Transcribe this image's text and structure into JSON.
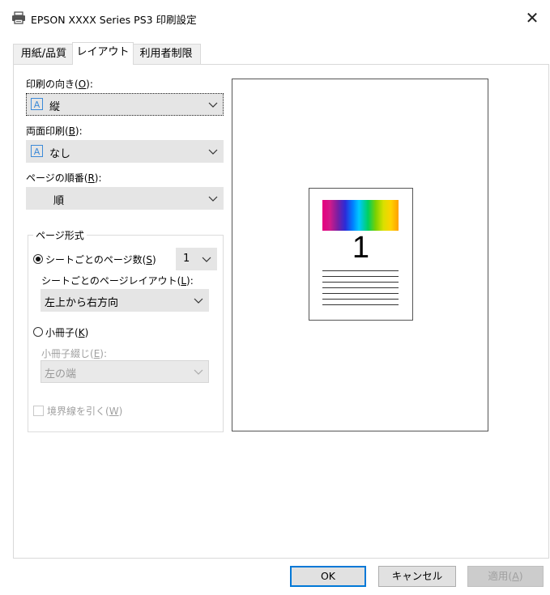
{
  "window": {
    "title": "EPSON XXXX Series PS3 印刷設定",
    "icon": "printer-icon",
    "close_glyph": "✕"
  },
  "tabs": [
    {
      "label": "用紙/品質",
      "active": false
    },
    {
      "label": "レイアウト",
      "active": true
    },
    {
      "label": "利用者制限",
      "active": false
    }
  ],
  "orientation": {
    "label": "印刷の向き(",
    "hotkey": "O",
    "suffix": "):",
    "value": "縦",
    "icon_glyph": "A"
  },
  "duplex": {
    "label": "両面印刷(",
    "hotkey": "B",
    "suffix": "):",
    "value": "なし",
    "icon_glyph": "A"
  },
  "page_order": {
    "label": "ページの順番(",
    "hotkey": "R",
    "suffix": "):",
    "value": "順"
  },
  "page_format": {
    "group_title": "ページ形式",
    "pages_per_sheet": {
      "label": "シートごとのページ数(",
      "hotkey": "S",
      "suffix": ")",
      "value": "1",
      "checked": true
    },
    "layout": {
      "label": "シートごとのページレイアウト(",
      "hotkey": "L",
      "suffix": "):",
      "value": "左上から右方向"
    },
    "booklet": {
      "label": "小冊子(",
      "hotkey": "K",
      "suffix": ")",
      "checked": false
    },
    "binding": {
      "label": "小冊子綴じ(",
      "hotkey": "E",
      "suffix": "):",
      "value": "左の端",
      "disabled": true
    },
    "border": {
      "label": "境界線を引く(",
      "hotkey": "W",
      "suffix": ")",
      "checked": false,
      "disabled": true
    }
  },
  "preview": {
    "page_number": "1",
    "colors": {
      "accent": "#0078d7",
      "icon_blue": "#3c8ad8"
    }
  },
  "buttons": {
    "ok": "OK",
    "cancel": "キャンセル",
    "apply_label": "適用(",
    "apply_hotkey": "A",
    "apply_suffix": ")"
  }
}
